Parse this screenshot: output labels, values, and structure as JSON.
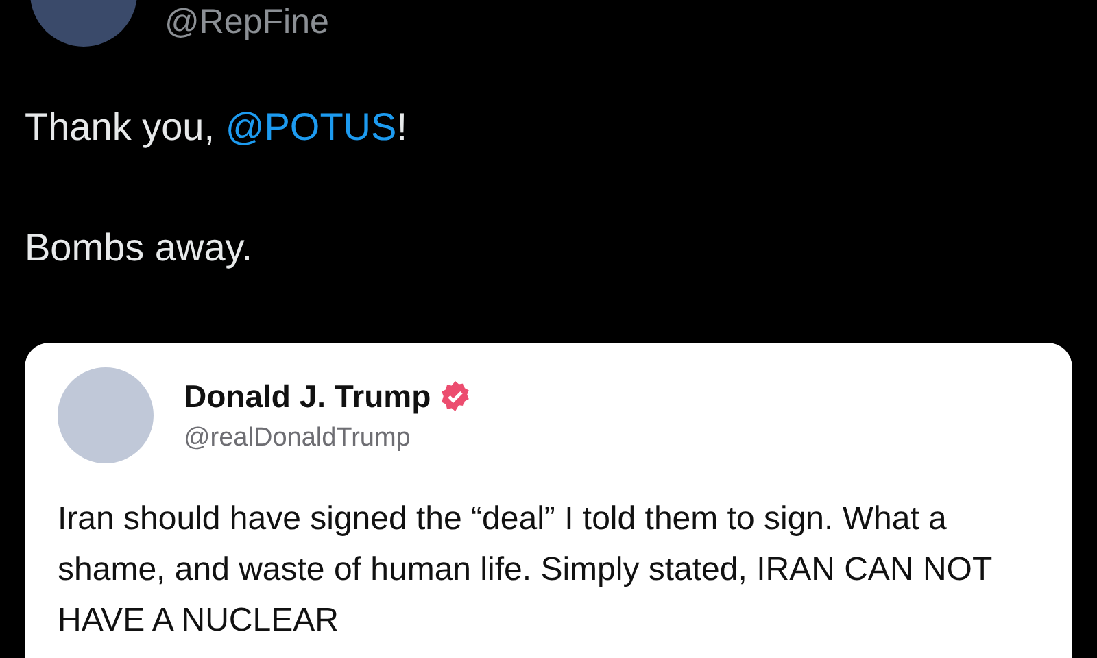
{
  "post": {
    "author_handle": "@RepFine",
    "paragraphs": [
      [
        {
          "kind": "text",
          "text": "Thank you, "
        },
        {
          "kind": "mention",
          "text": "@POTUS"
        },
        {
          "kind": "text",
          "text": "!"
        }
      ],
      [
        {
          "kind": "text",
          "text": "Bombs away."
        }
      ]
    ],
    "quoted_post": {
      "author_name": "Donald J. Trump",
      "verified": true,
      "author_handle": "@realDonaldTrump",
      "body": "Iran should have signed the “deal” I told them to sign. What a shame, and waste of human life. Simply stated, IRAN CAN NOT HAVE A NUCLEAR"
    }
  }
}
